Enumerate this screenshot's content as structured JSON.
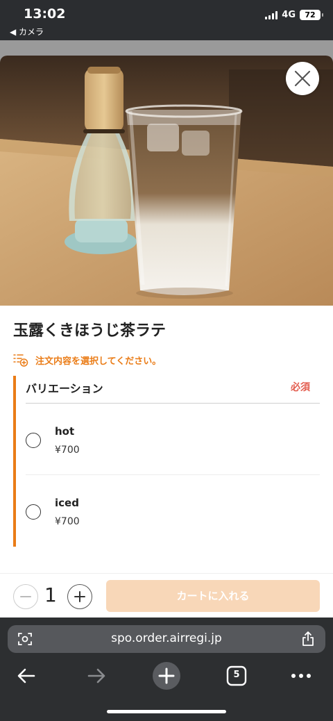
{
  "status_bar": {
    "time": "13:02",
    "back_label": "◀ カメラ",
    "network": "4G",
    "battery": "72"
  },
  "product": {
    "title": "玉露くきほうじ茶ラテ",
    "notice": "注文内容を選択してください。",
    "image_icon": "matcha-latte-photo"
  },
  "variation": {
    "title": "バリエーション",
    "required_label": "必須",
    "options": [
      {
        "name": "hot",
        "price": "¥700",
        "selected": false
      },
      {
        "name": "iced",
        "price": "¥700",
        "selected": false
      }
    ]
  },
  "cart": {
    "quantity": "1",
    "add_button_label": "カートに入れる"
  },
  "browser": {
    "url": "spo.order.airregi.jp",
    "tab_count": "5"
  },
  "colors": {
    "accent": "#ea7c17",
    "required": "#e35d4f",
    "cart_button_disabled": "#f8d7b8",
    "browser_chrome": "#2d2f31"
  }
}
